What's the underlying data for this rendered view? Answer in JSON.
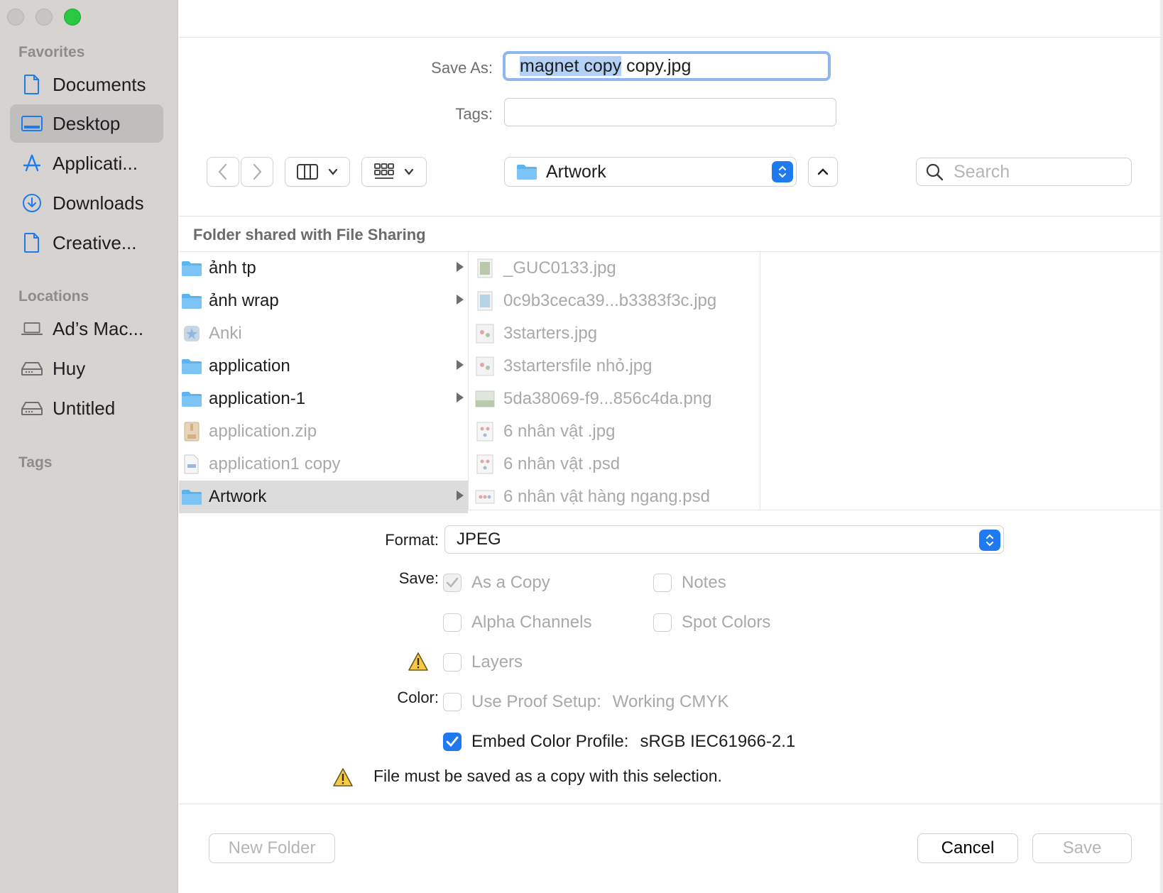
{
  "sidebar": {
    "sections": {
      "favorites": "Favorites",
      "locations": "Locations",
      "tags": "Tags"
    },
    "favorites": [
      {
        "label": "Documents",
        "icon": "document-icon"
      },
      {
        "label": "Desktop",
        "icon": "desktop-icon",
        "selected": true
      },
      {
        "label": "Applicati...",
        "icon": "applications-icon"
      },
      {
        "label": "Downloads",
        "icon": "downloads-icon"
      },
      {
        "label": "Creative...",
        "icon": "document-icon"
      }
    ],
    "locations": [
      {
        "label": "Ad’s Mac...",
        "icon": "laptop-icon"
      },
      {
        "label": "Huy",
        "icon": "drive-icon"
      },
      {
        "label": "Untitled",
        "icon": "drive-icon"
      }
    ]
  },
  "form": {
    "save_as_label": "Save As:",
    "save_as_selected": "magnet copy",
    "save_as_rest": " copy.jpg",
    "tags_label": "Tags:",
    "tags_value": ""
  },
  "toolbar": {
    "location": "Artwork",
    "search_placeholder": "Search"
  },
  "browser": {
    "title": "Folder shared with File Sharing",
    "column1": [
      {
        "name": "ảnh tp",
        "kind": "folder",
        "has_children": true
      },
      {
        "name": "ảnh wrap",
        "kind": "folder",
        "has_children": true
      },
      {
        "name": "Anki",
        "kind": "app",
        "dim": true
      },
      {
        "name": "application",
        "kind": "folder",
        "has_children": true
      },
      {
        "name": "application-1",
        "kind": "folder",
        "has_children": true
      },
      {
        "name": "application.zip",
        "kind": "zip",
        "dim": true
      },
      {
        "name": "application1 copy",
        "kind": "file",
        "dim": true
      },
      {
        "name": "Artwork",
        "kind": "folder",
        "has_children": true,
        "selected": true
      }
    ],
    "column2": [
      {
        "name": "_GUC0133.jpg",
        "kind": "image"
      },
      {
        "name": "0c9b3ceca39...b3383f3c.jpg",
        "kind": "image"
      },
      {
        "name": "3starters.jpg",
        "kind": "image"
      },
      {
        "name": "3startersfile nhỏ.jpg",
        "kind": "image"
      },
      {
        "name": "5da38069-f9...856c4da.png",
        "kind": "image"
      },
      {
        "name": "6 nhân vật .jpg",
        "kind": "image"
      },
      {
        "name": "6 nhân vật .psd",
        "kind": "image"
      },
      {
        "name": "6 nhân vật hàng ngang.psd",
        "kind": "image"
      }
    ]
  },
  "options": {
    "format_label": "Format:",
    "format_value": "JPEG",
    "save_label": "Save:",
    "color_label": "Color:",
    "as_a_copy": "As a Copy",
    "notes": "Notes",
    "alpha_channels": "Alpha Channels",
    "spot_colors": "Spot Colors",
    "layers": "Layers",
    "use_proof_setup": "Use Proof Setup:",
    "proof_value": "Working CMYK",
    "embed_color_profile": "Embed Color Profile:",
    "profile_value": "sRGB IEC61966-2.1",
    "warning": "File must be saved as a copy with this selection."
  },
  "footer": {
    "new_folder": "New Folder",
    "cancel": "Cancel",
    "save": "Save"
  },
  "colors": {
    "accent": "#1f7aef",
    "folder": "#5ab4f0",
    "sidebar_bg": "#d6d3d1",
    "selection": "#b3d1f6"
  }
}
